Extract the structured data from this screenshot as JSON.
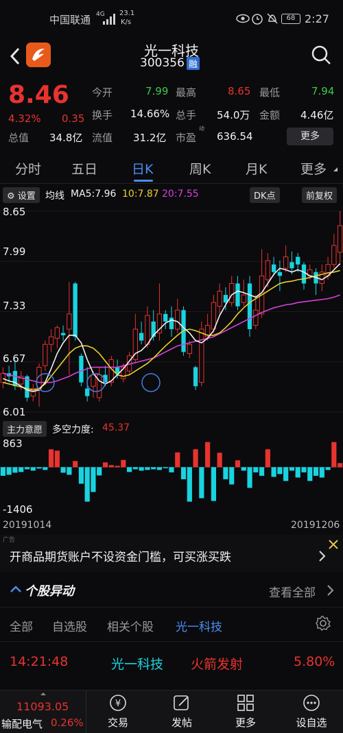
{
  "status": {
    "carrier": "中国联通",
    "network": "4G",
    "speed_value": "23.1",
    "speed_unit": "K/s",
    "battery": "68",
    "time": "2:27"
  },
  "header": {
    "stock_name": "光一科技",
    "stock_code": "300356",
    "margin_badge": "融"
  },
  "quote": {
    "price": "8.46",
    "change_pct": "4.32%",
    "change": "0.35",
    "fields": [
      {
        "label": "今开",
        "value": "7.99",
        "color": "green"
      },
      {
        "label": "最高",
        "value": "8.65",
        "color": "red"
      },
      {
        "label": "最低",
        "value": "7.94",
        "color": "green"
      },
      {
        "label": "换手",
        "value": "14.66%",
        "color": "white"
      },
      {
        "label": "总手",
        "value": "54.0万",
        "color": "white"
      },
      {
        "label": "金额",
        "value": "4.46亿",
        "color": "white"
      },
      {
        "label": "总值",
        "value": "34.8亿",
        "color": "white"
      },
      {
        "label": "流值",
        "value": "31.2亿",
        "color": "white"
      },
      {
        "label": "市盈",
        "value": "636.54",
        "color": "white"
      }
    ],
    "pe_sup": "动",
    "more_button": "更多"
  },
  "tabs": [
    "分时",
    "五日",
    "日K",
    "周K",
    "月K",
    "更多"
  ],
  "active_tab": 2,
  "ma_bar": {
    "settings": "设置",
    "label": "均线",
    "ma5": "MA5:7.96",
    "ma10": "10:7.87",
    "ma20": "20:7.55",
    "dk_button": "DK点",
    "adjust_button": "前复权"
  },
  "chart_data": {
    "type": "candlestick",
    "y_ticks": [
      "8.65",
      "7.99",
      "7.33",
      "6.67",
      "6.01"
    ],
    "ylim": [
      6.01,
      8.65
    ],
    "candles": [
      {
        "o": 6.4,
        "c": 6.52,
        "h": 6.6,
        "l": 6.32
      },
      {
        "o": 6.52,
        "c": 6.48,
        "h": 6.62,
        "l": 6.4
      },
      {
        "o": 6.55,
        "c": 6.35,
        "h": 6.7,
        "l": 6.3
      },
      {
        "o": 6.38,
        "c": 6.48,
        "h": 6.55,
        "l": 6.3
      },
      {
        "o": 6.48,
        "c": 6.2,
        "h": 6.5,
        "l": 6.15
      },
      {
        "o": 6.22,
        "c": 6.32,
        "h": 6.38,
        "l": 6.15
      },
      {
        "o": 6.3,
        "c": 6.6,
        "h": 6.65,
        "l": 6.08
      },
      {
        "o": 6.62,
        "c": 6.9,
        "h": 6.95,
        "l": 6.55
      },
      {
        "o": 6.9,
        "c": 7.0,
        "h": 7.1,
        "l": 6.8
      },
      {
        "o": 6.98,
        "c": 7.12,
        "h": 7.15,
        "l": 6.85
      },
      {
        "o": 7.05,
        "c": 7.02,
        "h": 7.15,
        "l": 6.95
      },
      {
        "o": 7.1,
        "c": 7.3,
        "h": 7.72,
        "l": 6.5
      },
      {
        "o": 7.7,
        "c": 7.0,
        "h": 7.72,
        "l": 6.95
      },
      {
        "o": 6.75,
        "c": 6.4,
        "h": 6.78,
        "l": 6.35
      },
      {
        "o": 6.32,
        "c": 6.22,
        "h": 6.6,
        "l": 6.15
      },
      {
        "o": 6.35,
        "c": 6.5,
        "h": 6.55,
        "l": 6.2
      },
      {
        "o": 6.2,
        "c": 6.5,
        "h": 6.6,
        "l": 6.15
      },
      {
        "o": 6.5,
        "c": 6.4,
        "h": 6.62,
        "l": 6.35
      },
      {
        "o": 6.4,
        "c": 6.7,
        "h": 6.75,
        "l": 6.35
      },
      {
        "o": 6.6,
        "c": 6.52,
        "h": 6.7,
        "l": 6.45
      },
      {
        "o": 6.45,
        "c": 6.6,
        "h": 6.65,
        "l": 6.4
      },
      {
        "o": 6.55,
        "c": 6.75,
        "h": 6.8,
        "l": 6.5
      },
      {
        "o": 6.7,
        "c": 7.1,
        "h": 7.3,
        "l": 6.65
      },
      {
        "o": 7.05,
        "c": 6.95,
        "h": 7.2,
        "l": 6.9
      },
      {
        "o": 6.9,
        "c": 7.28,
        "h": 7.4,
        "l": 6.85
      },
      {
        "o": 7.2,
        "c": 7.0,
        "h": 7.35,
        "l": 6.95
      },
      {
        "o": 7.05,
        "c": 7.3,
        "h": 7.7,
        "l": 6.95
      },
      {
        "o": 7.3,
        "c": 7.2,
        "h": 7.35,
        "l": 7.1
      },
      {
        "o": 7.25,
        "c": 7.1,
        "h": 7.4,
        "l": 7.0
      },
      {
        "o": 7.1,
        "c": 7.35,
        "h": 7.5,
        "l": 7.05
      },
      {
        "o": 7.35,
        "c": 6.8,
        "h": 7.4,
        "l": 6.75
      },
      {
        "o": 6.78,
        "c": 6.9,
        "h": 6.95,
        "l": 6.72
      },
      {
        "o": 6.6,
        "c": 6.35,
        "h": 6.62,
        "l": 6.3
      },
      {
        "o": 6.4,
        "c": 7.1,
        "h": 7.2,
        "l": 6.35
      },
      {
        "o": 7.0,
        "c": 7.15,
        "h": 7.3,
        "l": 6.95
      },
      {
        "o": 7.1,
        "c": 7.45,
        "h": 7.55,
        "l": 7.05
      },
      {
        "o": 7.4,
        "c": 7.6,
        "h": 7.7,
        "l": 7.3
      },
      {
        "o": 7.55,
        "c": 7.45,
        "h": 7.65,
        "l": 7.35
      },
      {
        "o": 7.45,
        "c": 7.7,
        "h": 7.8,
        "l": 7.4
      },
      {
        "o": 7.7,
        "c": 7.4,
        "h": 7.8,
        "l": 7.35
      },
      {
        "o": 7.45,
        "c": 7.55,
        "h": 7.75,
        "l": 7.4
      },
      {
        "o": 7.7,
        "c": 7.1,
        "h": 7.8,
        "l": 7.0
      },
      {
        "o": 7.15,
        "c": 7.35,
        "h": 7.55,
        "l": 7.1
      },
      {
        "o": 7.3,
        "c": 7.8,
        "h": 8.15,
        "l": 7.25
      },
      {
        "o": 7.75,
        "c": 8.0,
        "h": 8.1,
        "l": 7.65
      },
      {
        "o": 7.95,
        "c": 7.85,
        "h": 8.05,
        "l": 7.8
      },
      {
        "o": 7.85,
        "c": 7.8,
        "h": 8.0,
        "l": 7.6
      },
      {
        "o": 7.9,
        "c": 8.05,
        "h": 8.2,
        "l": 7.85
      },
      {
        "o": 7.98,
        "c": 7.9,
        "h": 8.12,
        "l": 7.82
      },
      {
        "o": 8.05,
        "c": 7.95,
        "h": 8.1,
        "l": 7.85
      },
      {
        "o": 7.95,
        "c": 7.7,
        "h": 7.98,
        "l": 7.62
      },
      {
        "o": 7.8,
        "c": 7.88,
        "h": 7.95,
        "l": 7.75
      },
      {
        "o": 7.85,
        "c": 7.7,
        "h": 7.9,
        "l": 7.55
      },
      {
        "o": 7.7,
        "c": 7.85,
        "h": 7.95,
        "l": 7.6
      },
      {
        "o": 7.8,
        "c": 7.95,
        "h": 8.05,
        "l": 7.75
      },
      {
        "o": 7.95,
        "c": 8.2,
        "h": 8.35,
        "l": 7.9
      },
      {
        "o": 8.11,
        "c": 8.46,
        "h": 8.65,
        "l": 7.94
      }
    ],
    "ma5": [
      6.45,
      6.42,
      6.4,
      6.35,
      6.3,
      6.28,
      6.3,
      6.4,
      6.58,
      6.78,
      6.92,
      7.02,
      7.02,
      6.92,
      6.7,
      6.52,
      6.42,
      6.38,
      6.42,
      6.5,
      6.58,
      6.68,
      6.78,
      6.82,
      6.9,
      7.02,
      7.1,
      7.18,
      7.22,
      7.2,
      7.12,
      7.05,
      6.95,
      6.92,
      6.98,
      7.08,
      7.28,
      7.42,
      7.55,
      7.6,
      7.58,
      7.55,
      7.52,
      7.58,
      7.7,
      7.82,
      7.9,
      7.88,
      7.85,
      7.88,
      7.85,
      7.8,
      7.78,
      7.75,
      7.8,
      7.88,
      7.96
    ],
    "ma10": [
      6.4,
      6.38,
      6.36,
      6.34,
      6.32,
      6.3,
      6.32,
      6.38,
      6.48,
      6.58,
      6.68,
      6.78,
      6.85,
      6.88,
      6.88,
      6.85,
      6.78,
      6.68,
      6.58,
      6.5,
      6.48,
      6.5,
      6.55,
      6.6,
      6.65,
      6.72,
      6.8,
      6.88,
      6.95,
      7.02,
      7.08,
      7.1,
      7.08,
      7.05,
      7.02,
      7.02,
      7.05,
      7.12,
      7.2,
      7.3,
      7.38,
      7.45,
      7.5,
      7.55,
      7.6,
      7.65,
      7.7,
      7.72,
      7.73,
      7.75,
      7.76,
      7.78,
      7.8,
      7.82,
      7.84,
      7.85,
      7.87
    ],
    "ma20": [
      6.52,
      6.5,
      6.48,
      6.46,
      6.44,
      6.42,
      6.4,
      6.4,
      6.4,
      6.42,
      6.45,
      6.48,
      6.52,
      6.55,
      6.58,
      6.6,
      6.6,
      6.6,
      6.6,
      6.6,
      6.62,
      6.64,
      6.66,
      6.68,
      6.7,
      6.72,
      6.76,
      6.8,
      6.84,
      6.88,
      6.9,
      6.92,
      6.94,
      6.96,
      6.98,
      7.0,
      7.04,
      7.08,
      7.12,
      7.16,
      7.2,
      7.24,
      7.28,
      7.32,
      7.35,
      7.38,
      7.4,
      7.42,
      7.43,
      7.45,
      7.46,
      7.47,
      7.48,
      7.49,
      7.5,
      7.52,
      7.55
    ]
  },
  "sub_indicator": {
    "button": "主力意愿",
    "label": "多空力度:",
    "value": "45.37",
    "y_top": "863",
    "y_bottom": "-1406",
    "bars": [
      -250,
      -220,
      -160,
      -140,
      -60,
      -100,
      -40,
      -80,
      520,
      480,
      -160,
      -220,
      180,
      -480,
      -1000,
      -720,
      -240,
      140,
      60,
      40,
      210,
      -140,
      -60,
      -100,
      -80,
      -60,
      -80,
      -30,
      -150,
      430,
      -350,
      -1000,
      520,
      -900,
      730,
      -980,
      420,
      -350,
      -500,
      200,
      -100,
      -600,
      -150,
      -250,
      520,
      -280,
      -200,
      -400,
      -100,
      -300,
      -150,
      -400,
      -250,
      -300,
      -80,
      730,
      120
    ]
  },
  "dates": {
    "start": "20191014",
    "end": "20191206"
  },
  "ad": {
    "tag": "广告",
    "text": "开商品期货账户不设资金门槛，可买涨买跌"
  },
  "section": {
    "title": "个股异动",
    "view_all": "查看全部"
  },
  "filters": {
    "items": [
      "全部",
      "自选股",
      "相关个股",
      "光一科技"
    ],
    "active": 3
  },
  "alert": {
    "time": "14:21:48",
    "stock": "光一科技",
    "event": "火箭发射",
    "pct": "5.80%"
  },
  "bottom_nav": {
    "index_value": "11093.05",
    "index_name": "输配电气",
    "index_pct": "0.26%",
    "items": [
      "交易",
      "发帖",
      "更多",
      "设自选"
    ]
  }
}
